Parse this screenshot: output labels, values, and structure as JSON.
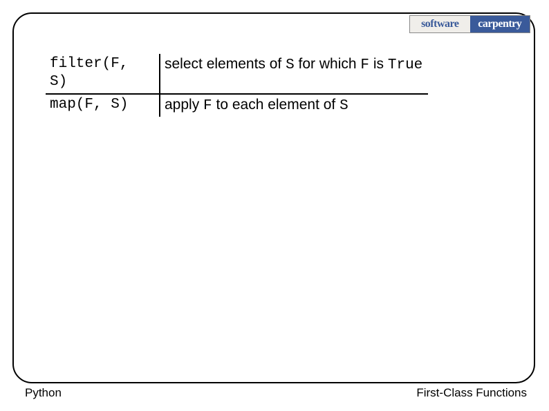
{
  "logo": {
    "left": "software",
    "right": "carpentry"
  },
  "table": {
    "rows": [
      {
        "func": "filter(F, S)",
        "desc_parts": [
          "select elements of ",
          "S",
          " for which ",
          "F",
          " is ",
          "True"
        ]
      },
      {
        "func": "map(F, S)",
        "desc_parts": [
          "apply ",
          "F",
          " to each element of ",
          "S"
        ]
      }
    ]
  },
  "footer": {
    "left": "Python",
    "right": "First-Class Functions"
  }
}
